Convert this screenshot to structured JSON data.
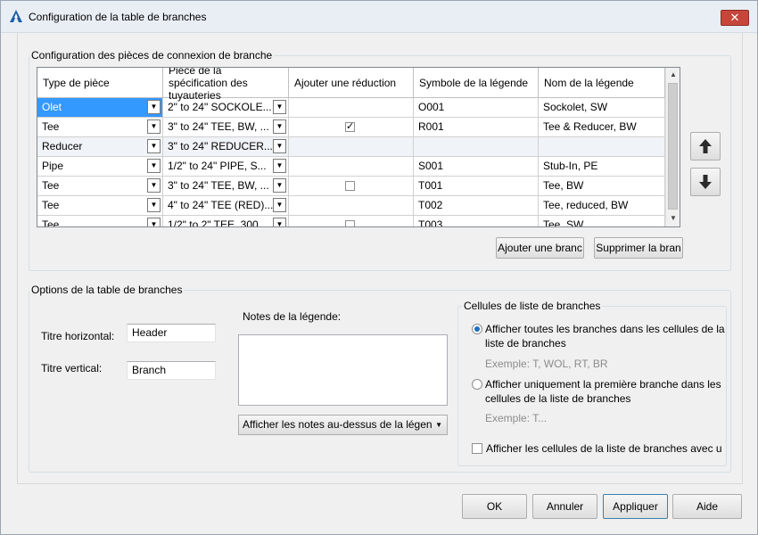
{
  "window": {
    "title": "Configuration de la table de branches",
    "close_glyph": "✕",
    "app_icon": "autocad-plant-icon"
  },
  "connections_group": {
    "legend": "Configuration des pièces de connexion de branche",
    "columns": [
      "Type de pièce",
      "Pièce de la spécification des tuyauteries",
      "Ajouter une réduction",
      "Symbole de la légende",
      "Nom de la légende"
    ],
    "rows": [
      {
        "type": "Olet",
        "spec": "2\" to 24\"  SOCKOLE...",
        "reduction": "none",
        "symbol": "O001",
        "name": "Sockolet, SW",
        "selected": true
      },
      {
        "type": "Tee",
        "spec": "3\" to 24\"  TEE, BW, ...",
        "reduction": "checked",
        "symbol": "R001",
        "name": "Tee & Reducer, BW",
        "selected": false
      },
      {
        "type": "Reducer",
        "spec": "3\" to 24\"  REDUCER...",
        "reduction": "none",
        "symbol": "",
        "name": "",
        "selected": false
      },
      {
        "type": "Pipe",
        "spec": "1/2\" to 24\"  PIPE, S...",
        "reduction": "none",
        "symbol": "S001",
        "name": "Stub-In, PE",
        "selected": false
      },
      {
        "type": "Tee",
        "spec": "3\" to 24\"  TEE, BW, ...",
        "reduction": "unchecked",
        "symbol": "T001",
        "name": "Tee, BW",
        "selected": false
      },
      {
        "type": "Tee",
        "spec": "4\" to 24\"  TEE (RED)...",
        "reduction": "none",
        "symbol": "T002",
        "name": "Tee, reduced, BW",
        "selected": false
      },
      {
        "type": "Tee",
        "spec": "1/2\" to 2\"  TEE, 300...",
        "reduction": "unchecked",
        "symbol": "T003",
        "name": "Tee, SW",
        "selected": false
      }
    ],
    "add_button": "Ajouter une branc",
    "delete_button": "Supprimer la bran",
    "move_up_icon": "arrow-up-icon",
    "move_down_icon": "arrow-down-icon"
  },
  "options_group": {
    "legend": "Options de la table de branches",
    "horizontal_title_label": "Titre horizontal:",
    "horizontal_title_value": "Header",
    "vertical_title_label": "Titre vertical:",
    "vertical_title_value": "Branch",
    "notes_label": "Notes de la légende:",
    "notes_value": "",
    "notes_position": "Afficher les notes au-dessus de la légen",
    "cells_group": {
      "legend": "Cellules de liste de branches",
      "option_all_line1": "Afficher toutes les branches dans les cellules de la",
      "option_all_line2": "liste de branches",
      "option_all_example": "Exemple: T, WOL, RT, BR",
      "option_first_line1": "Afficher uniquement la première branche dans les",
      "option_first_line2": "cellules de la liste de branches",
      "option_first_example": "Exemple: T...",
      "show_cells_checkbox": "Afficher les cellules de la liste de branches avec un"
    }
  },
  "footer": {
    "ok": "OK",
    "cancel": "Annuler",
    "apply": "Appliquer",
    "help": "Aide"
  },
  "colors": {
    "selection": "#3399ff",
    "close_button": "#c7463b",
    "radio_dot": "#1c6fc1"
  }
}
